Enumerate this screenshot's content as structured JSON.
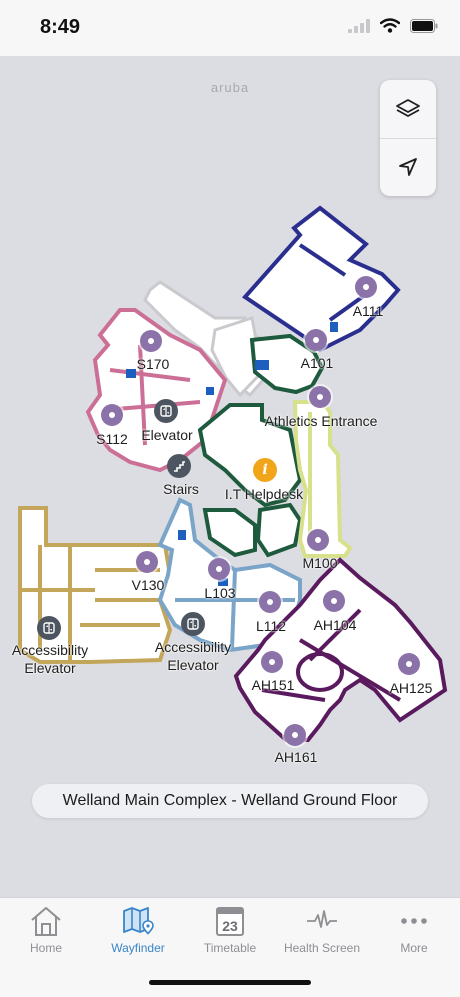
{
  "status_bar": {
    "time": "8:49"
  },
  "map": {
    "brand": "aruba",
    "controls": {
      "layers_icon": "layers-icon",
      "locate_icon": "navigation-arrow-icon"
    },
    "labels": {
      "a111": "A111",
      "a101": "A101",
      "s170": "S170",
      "s112": "S112",
      "elevator_s": "Elevator",
      "athletics": "Athletics Entrance",
      "stairs": "Stairs",
      "helpdesk": "I.T Helpdesk",
      "m100": "M100",
      "v130": "V130",
      "l103": "L103",
      "ah104": "AH104",
      "l112": "L112",
      "accessibility_elevator_left": "Accessibility\nElevator",
      "accessibility_elevator_center": "Accessibility\nElevator",
      "ah151": "AH151",
      "ah125": "AH125",
      "ah161": "AH161"
    },
    "zone_colors": {
      "a_wing": "#2a2f8f",
      "s_wing": "#cc6f96",
      "athletics": "#1e5a3d",
      "m_wing": "#d7e08a",
      "v_wing": "#c3a659",
      "l_wing": "#7aa4c8",
      "ah_wing": "#5a1a5e",
      "corridor": "#ffffff"
    },
    "location_banner": "Welland Main Complex - Welland Ground Floor"
  },
  "tabbar": {
    "tabs": [
      {
        "label": "Home",
        "icon": "home-icon"
      },
      {
        "label": "Wayfinder",
        "icon": "map-icon"
      },
      {
        "label": "Timetable",
        "icon": "calendar-icon"
      },
      {
        "label": "Health Screen",
        "icon": "heartbeat-icon"
      },
      {
        "label": "More",
        "icon": "more-dots-icon"
      }
    ],
    "calendar_day": "23",
    "active_tab": "Wayfinder",
    "active_color": "#3a85c7",
    "inactive_color": "#8e8e93"
  }
}
